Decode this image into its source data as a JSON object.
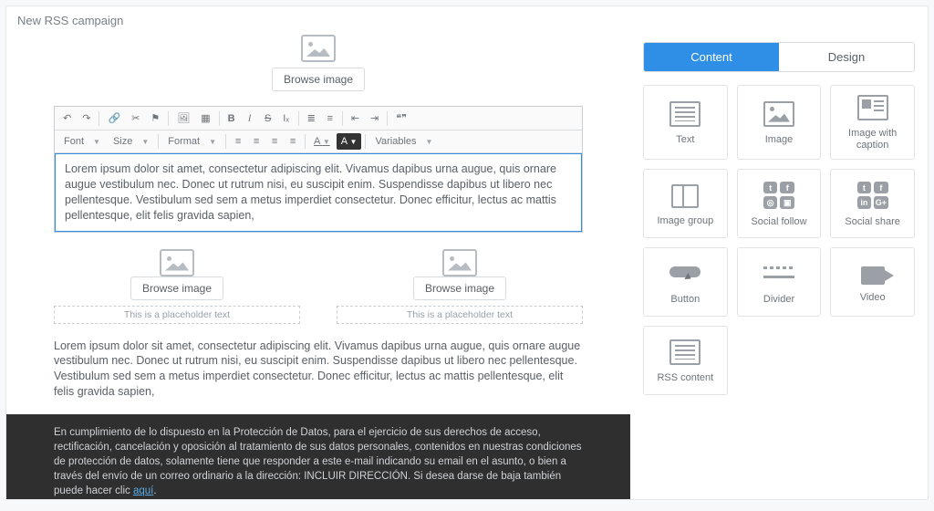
{
  "header": {
    "title": "New RSS campaign"
  },
  "canvas": {
    "browse_image_label": "Browse image",
    "lorem": "Lorem ipsum dolor sit amet, consectetur adipiscing elit. Vivamus dapibus urna augue, quis ornare augue vestibulum nec. Donec ut rutrum nisi, eu suscipit enim. Suspendisse dapibus ut libero nec pellentesque. Vestibulum sed sem a metus imperdiet consectetur. Donec efficitur, lectus ac mattis pellentesque, elit felis gravida sapien,",
    "placeholder_text": "This is a placeholder text",
    "footer_text": "En cumplimiento de lo dispuesto en la Protección de Datos, para el ejercicio de sus derechos de acceso, rectificación, cancelación y oposición al tratamiento de sus datos personales, contenidos en nuestras condiciones de protección de datos, solamente tiene que responder a este e-mail indicando su email en el asunto, o bien a través del envío de un correo ordinario a la dirección: INCLUIR DIRECCIÓN. Si desea darse de baja también puede hacer clic ",
    "footer_link": "aquí"
  },
  "editor_toolbar": {
    "row1": {
      "undo": "↶",
      "redo": "↷",
      "link": "🔗",
      "unlink": "✂",
      "anchor": "⚑",
      "image": "🖼",
      "table": "▦",
      "bold": "B",
      "italic": "I",
      "strike": "S",
      "clear": "Iₓ",
      "ol": "≣",
      "ul": "≡",
      "outdent": "⇤",
      "indent": "⇥",
      "quote": "❝❞"
    },
    "row2": {
      "font": "Font",
      "size": "Size",
      "format": "Format",
      "align_left": "≡",
      "align_center": "≡",
      "align_right": "≡",
      "align_just": "≡",
      "text_color": "A",
      "bg_color": "A",
      "variables": "Variables"
    }
  },
  "sidebar": {
    "tabs": {
      "content": "Content",
      "design": "Design"
    },
    "blocks": [
      {
        "key": "text",
        "label": "Text"
      },
      {
        "key": "image",
        "label": "Image"
      },
      {
        "key": "image-caption",
        "label": "Image with caption"
      },
      {
        "key": "image-group",
        "label": "Image group"
      },
      {
        "key": "social-follow",
        "label": "Social follow"
      },
      {
        "key": "social-share",
        "label": "Social share"
      },
      {
        "key": "button",
        "label": "Button"
      },
      {
        "key": "divider",
        "label": "Divider"
      },
      {
        "key": "video",
        "label": "Video"
      },
      {
        "key": "rss-content",
        "label": "RSS content"
      }
    ]
  }
}
